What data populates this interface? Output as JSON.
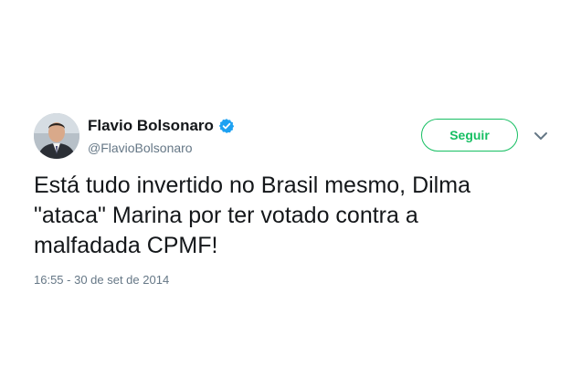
{
  "author": {
    "display_name": "Flavio Bolsonaro",
    "handle": "@FlavioBolsonaro",
    "verified": true
  },
  "follow_button": {
    "label": "Seguir",
    "color": "#17bf63"
  },
  "tweet": {
    "lines": [
      "Está tudo invertido no Brasil mesmo, Dilma",
      "\"ataca\" Marina por ter votado contra a",
      "malfadada CPMF!"
    ],
    "timestamp": "16:55 - 30 de set de 2014"
  },
  "icons": {
    "verified": "verified-badge-icon",
    "more": "chevron-down-icon"
  },
  "colors": {
    "verified_blue": "#1da1f2",
    "secondary_text": "#657786",
    "primary_text": "#14171a"
  }
}
